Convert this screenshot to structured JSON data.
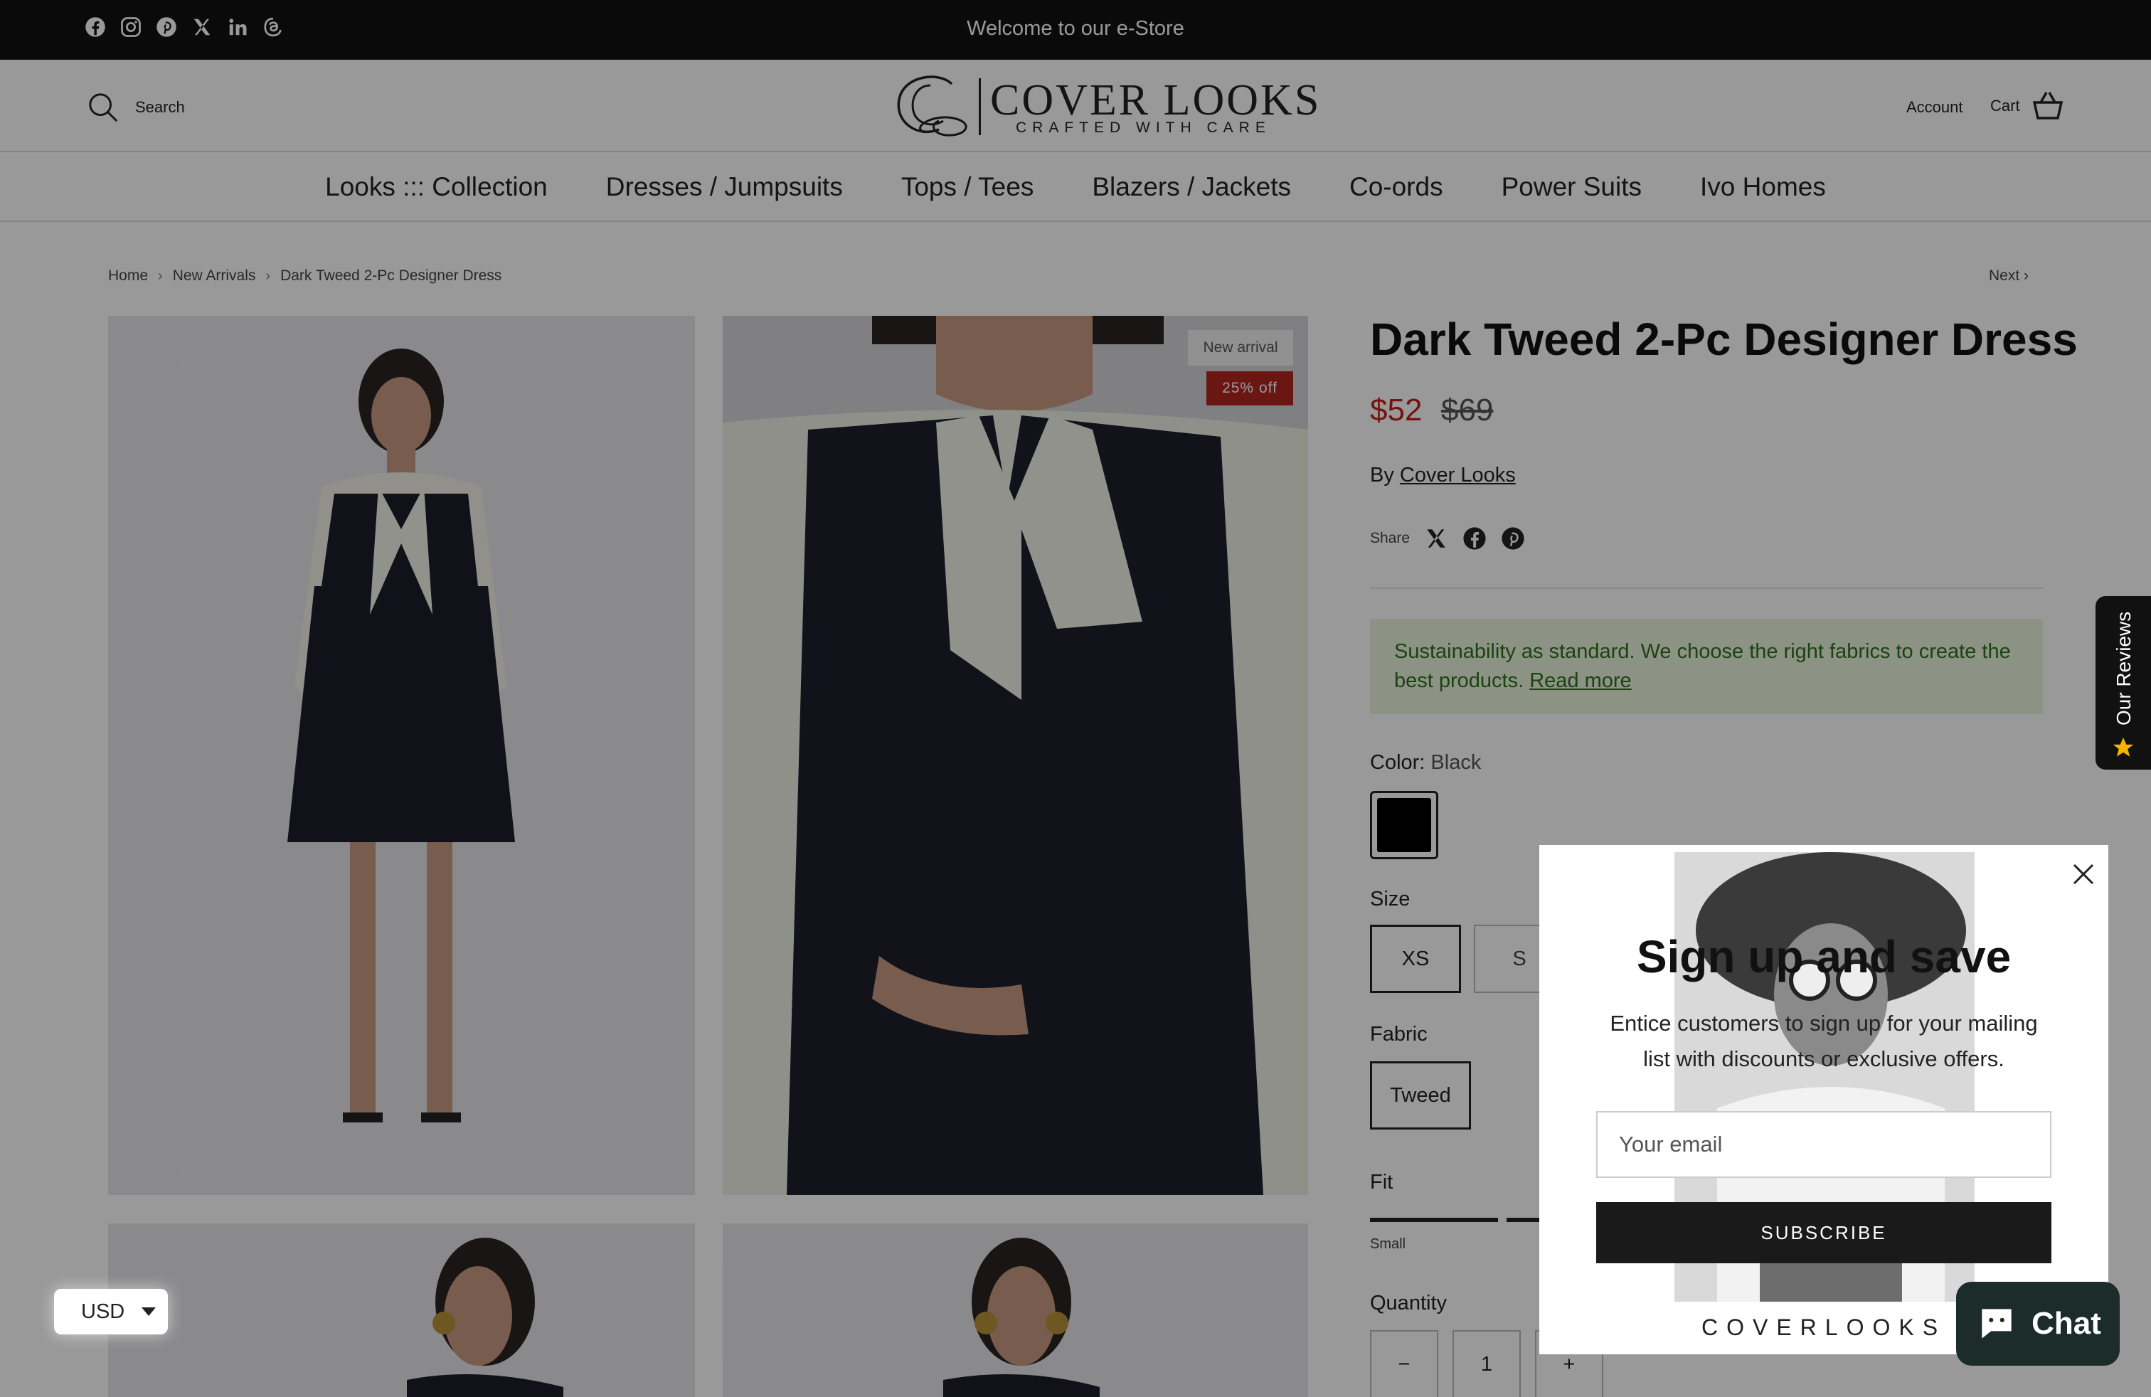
{
  "topbar": {
    "welcome": "Welcome to our e-Store",
    "social_icons": [
      "facebook-icon",
      "instagram-icon",
      "pinterest-icon",
      "x-icon",
      "linkedin-icon",
      "threads-icon"
    ]
  },
  "header": {
    "search_label": "Search",
    "logo_name": "COVER LOOKS",
    "logo_tagline": "CRAFTED WITH CARE",
    "account_label": "Account",
    "cart_label": "Cart"
  },
  "nav": {
    "items": [
      "Looks ::: Collection",
      "Dresses / Jumpsuits",
      "Tops / Tees",
      "Blazers / Jackets",
      "Co-ords",
      "Power Suits",
      "Ivo Homes"
    ]
  },
  "breadcrumb": {
    "items": [
      "Home",
      "New Arrivals",
      "Dark Tweed 2-Pc Designer Dress"
    ],
    "next_label": "Next"
  },
  "gallery": {
    "badge_new": "New arrival",
    "badge_discount": "25% off"
  },
  "product": {
    "title": "Dark Tweed 2-Pc Designer Dress",
    "price": "$52",
    "compare_price": "$69",
    "by_prefix": "By",
    "vendor": "Cover Looks",
    "share_label": "Share",
    "sustainability_text": "Sustainability as standard. We choose the right fabrics to create the best products.",
    "read_more": "Read more",
    "color_label": "Color:",
    "color_value": "Black",
    "size_label": "Size",
    "sizes": [
      "XS",
      "S"
    ],
    "fabric_label": "Fabric",
    "fabric_value": "Tweed",
    "fit_label": "Fit",
    "fit_value": "Small",
    "quantity_label": "Quantity",
    "quantity_value": "1",
    "quantity_minus": "−",
    "quantity_plus": "+",
    "accent_color": "#c0221b"
  },
  "popup": {
    "title": "Sign up and save",
    "subtitle": "Entice customers to sign up for your mailing list with discounts or exclusive offers.",
    "email_placeholder": "Your email",
    "subscribe_label": "SUBSCRIBE",
    "brand": "COVERLOOKS"
  },
  "reviews_tab": {
    "label": "Our Reviews"
  },
  "currency": {
    "value": "USD"
  },
  "chat": {
    "label": "Chat"
  }
}
